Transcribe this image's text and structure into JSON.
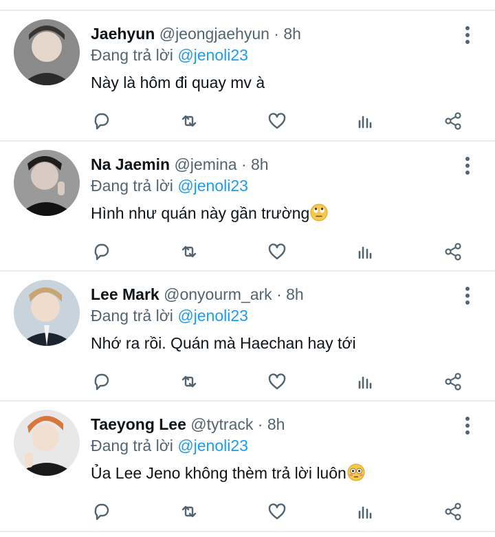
{
  "reply_prefix": "Đang trả lời",
  "tweets": [
    {
      "name": "Jaehyun",
      "handle": "@jeongjaehyun",
      "dot": " · ",
      "time": "8h",
      "mention": "@jenoli23",
      "text": "Này là hôm đi quay mv à",
      "emoji": ""
    },
    {
      "name": "Na Jaemin",
      "handle": "@jemina",
      "dot": " · ",
      "time": "8h",
      "mention": "@jenoli23",
      "text": "Hình như quán này gần trường",
      "emoji": "eye-roll-emoji"
    },
    {
      "name": "Lee Mark",
      "handle": "@onyourm_ark",
      "dot": " · ",
      "time": "8h",
      "mention": "@jenoli23",
      "text": "Nhớ ra rồi. Quán mà Haechan hay tới",
      "emoji": ""
    },
    {
      "name": "Taeyong Lee",
      "handle": "@tytrack",
      "dot": " · ",
      "time": "8h",
      "mention": "@jenoli23",
      "text": "Ủa Lee Jeno không thèm trả lời luôn",
      "emoji": "flushed-emoji"
    }
  ],
  "icons": [
    "comment-icon",
    "retweet-icon",
    "like-icon",
    "analytics-icon",
    "share-icon",
    "more-vertical-icon"
  ],
  "colors": {
    "name": "#0f1419",
    "meta": "#536471",
    "mention": "#1d9bf0",
    "separator": "#e6ecf0"
  }
}
